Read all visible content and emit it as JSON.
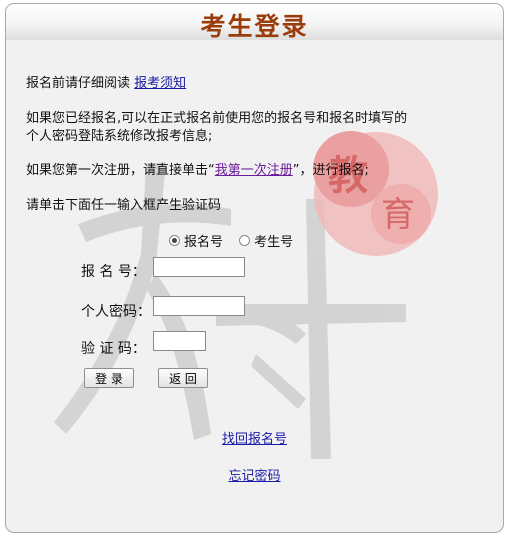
{
  "header": {
    "title": "考生登录"
  },
  "intro": {
    "prefix": "报名前请仔细阅读",
    "link": "报考须知"
  },
  "notice": {
    "line1": "如果您已经报名,可以在正式报名前使用您的报名号和报名时填写的",
    "line2": "个人密码登陆系统修改报考信息;"
  },
  "first_time": {
    "prefix": "如果您第一次注册，请直接单击“",
    "link": "我第一次注册",
    "suffix": "”，进行报名;"
  },
  "instruction": "请单击下面任一输入框产生验证码",
  "login_type": {
    "options": [
      "报名号",
      "考生号"
    ],
    "selected": "报名号"
  },
  "form": {
    "reg_label": "报 名 号：",
    "password_label": "个人密码：",
    "captcha_label": "验 证 码："
  },
  "buttons": {
    "login": "登 录",
    "back": "返 回"
  },
  "links": {
    "find_reg": "找回报名号",
    "forgot_pwd": "忘记密码"
  },
  "colors": {
    "title": "#9b3d0b",
    "link": "#1a1aa6",
    "seal": "#e05a5a"
  }
}
